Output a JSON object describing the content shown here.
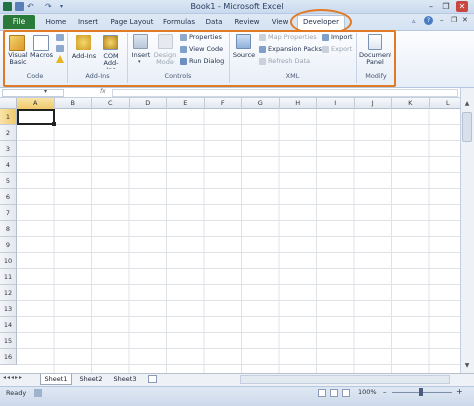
{
  "window": {
    "title": "Book1 - Microsoft Excel",
    "minimize": "–",
    "restore": "❐",
    "close": "✕"
  },
  "tabs": [
    "File",
    "Home",
    "Insert",
    "Page Layout",
    "Formulas",
    "Data",
    "Review",
    "View",
    "Developer"
  ],
  "ribbon": {
    "code": {
      "label": "Code",
      "visual_basic": "Visual Basic",
      "macros": "Macros"
    },
    "addins": {
      "label": "Add-Ins",
      "addins": "Add-Ins",
      "com_addins": "COM Add-Ins"
    },
    "controls": {
      "label": "Controls",
      "insert": "Insert",
      "design_mode": "Design Mode",
      "properties": "Properties",
      "view_code": "View Code",
      "run_dialog": "Run Dialog"
    },
    "xml": {
      "label": "XML",
      "source": "Source",
      "map_properties": "Map Properties",
      "expansion_packs": "Expansion Packs",
      "refresh_data": "Refresh Data",
      "import": "Import",
      "export": "Export"
    },
    "modify": {
      "label": "Modify",
      "document_panel": "Document Panel"
    }
  },
  "formula_bar": {
    "fx": "fx"
  },
  "grid": {
    "columns": [
      "A",
      "B",
      "C",
      "D",
      "E",
      "F",
      "G",
      "H",
      "I",
      "J",
      "K",
      "L"
    ],
    "rows": [
      "1",
      "2",
      "3",
      "4",
      "5",
      "6",
      "7",
      "8",
      "9",
      "10",
      "11",
      "12",
      "13",
      "14",
      "15",
      "16"
    ],
    "active_cell": "A1"
  },
  "sheets": [
    "Sheet1",
    "Sheet2",
    "Sheet3"
  ],
  "status": {
    "ready": "Ready",
    "zoom": "100%"
  },
  "colors": {
    "accent": "#e07a24",
    "file_tab": "#2a7a3a",
    "ribbon": "#e7eef8"
  }
}
